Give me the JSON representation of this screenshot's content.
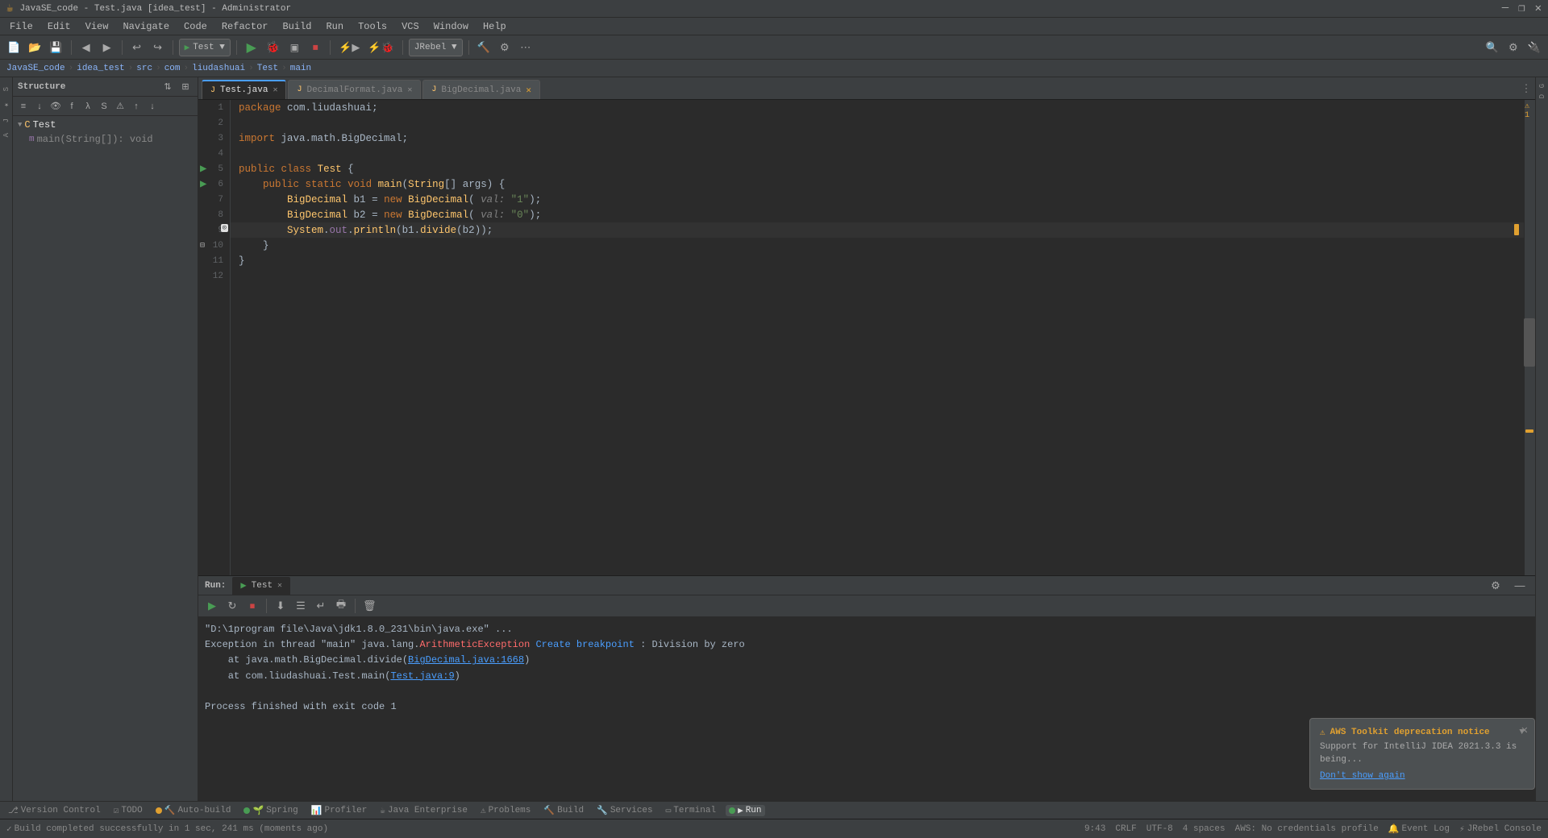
{
  "titlebar": {
    "title": "JavaSE_code - Test.java [idea_test] - Administrator",
    "minimize": "—",
    "maximize": "❐",
    "close": "✕"
  },
  "menubar": {
    "items": [
      "File",
      "Edit",
      "View",
      "Navigate",
      "Code",
      "Refactor",
      "Build",
      "Run",
      "Tools",
      "VCS",
      "Window",
      "Help"
    ]
  },
  "toolbar": {
    "run_config": "JRebel ▼",
    "run_button_label": "Test ▼"
  },
  "breadcrumb": {
    "parts": [
      "JavaSE_code",
      "idea_test",
      "src",
      "com",
      "liudashuai",
      "Test",
      "main"
    ]
  },
  "tabs": [
    {
      "label": "Test.java",
      "active": true,
      "modified": false,
      "close": "✕"
    },
    {
      "label": "DecimalFormat.java",
      "active": false,
      "modified": false,
      "close": "✕"
    },
    {
      "label": "BigDecimal.java",
      "active": false,
      "modified": false,
      "close": "✕"
    }
  ],
  "structure_panel": {
    "title": "Structure",
    "items": [
      {
        "label": "Test",
        "type": "class",
        "indent": 0
      },
      {
        "label": "main(String[]): void",
        "type": "method",
        "indent": 1
      }
    ]
  },
  "code": {
    "lines": [
      {
        "num": 1,
        "text": "package com.liudashuai;"
      },
      {
        "num": 2,
        "text": ""
      },
      {
        "num": 3,
        "text": "import java.math.BigDecimal;"
      },
      {
        "num": 4,
        "text": ""
      },
      {
        "num": 5,
        "text": "public class Test {"
      },
      {
        "num": 6,
        "text": "    public static void main(String[] args) {"
      },
      {
        "num": 7,
        "text": "        BigDecimal b1 = new BigDecimal( val: \"1\");"
      },
      {
        "num": 8,
        "text": "        BigDecimal b2 = new BigDecimal( val: \"0\");"
      },
      {
        "num": 9,
        "text": "        System.out.println(b1.divide(b2));"
      },
      {
        "num": 10,
        "text": "    }"
      },
      {
        "num": 11,
        "text": "}"
      },
      {
        "num": 12,
        "text": ""
      }
    ]
  },
  "run_panel": {
    "title": "Run:",
    "tab_label": "Test",
    "console_lines": [
      {
        "type": "path",
        "text": "\"D:\\1program file\\Java\\jdk1.8.0_231\\bin\\java.exe\" ..."
      },
      {
        "type": "error",
        "prefix": "Exception in thread \"main\" java.lang.",
        "error_class": "ArithmeticException",
        "middle": " Create breakpoint ",
        "suffix": ": Division by zero"
      },
      {
        "type": "stack",
        "prefix": "\tat java.math.BigDecimal.divide(",
        "link": "BigDecimal.java:1668",
        "suffix": ")"
      },
      {
        "type": "stack",
        "prefix": "\tat com.liudashuai.Test.main(",
        "link": "Test.java:9",
        "suffix": ")"
      },
      {
        "type": "blank"
      },
      {
        "type": "exit",
        "text": "Process finished with exit code 1"
      }
    ]
  },
  "bottom_toolbar": {
    "items": [
      {
        "label": "Version Control",
        "icon": "git-icon"
      },
      {
        "label": "TODO",
        "icon": "todo-icon"
      },
      {
        "label": "Auto-build",
        "icon": "build-icon",
        "dot_color": "yellow"
      },
      {
        "label": "Spring",
        "icon": "spring-icon",
        "dot_color": "green"
      },
      {
        "label": "Profiler",
        "icon": "profiler-icon",
        "dot_color": "none"
      },
      {
        "label": "Java Enterprise",
        "icon": "je-icon",
        "dot_color": "none"
      },
      {
        "label": "Problems",
        "icon": "problems-icon",
        "dot_color": "none"
      },
      {
        "label": "Build",
        "icon": "build2-icon",
        "dot_color": "none"
      },
      {
        "label": "Services",
        "icon": "services-icon",
        "dot_color": "none"
      },
      {
        "label": "Terminal",
        "icon": "terminal-icon",
        "dot_color": "none"
      },
      {
        "label": "Run",
        "icon": "run-icon",
        "dot_color": "green",
        "active": true
      }
    ]
  },
  "statusbar": {
    "build_status": "Build completed successfully in 1 sec, 241 ms (moments ago)",
    "time": "9:43",
    "encoding": "CRLF",
    "charset": "UTF-8",
    "indent": "4 spaces",
    "aws": "AWS: No credentials profile",
    "event_log": "Event Log",
    "jrebel": "JRebel Console",
    "warning": "⚠ 1"
  },
  "aws_notification": {
    "title": "AWS Toolkit deprecation notice",
    "body": "Support for IntelliJ IDEA 2021.3.3 is being...",
    "link": "Don't show again",
    "triangle": "▼"
  }
}
